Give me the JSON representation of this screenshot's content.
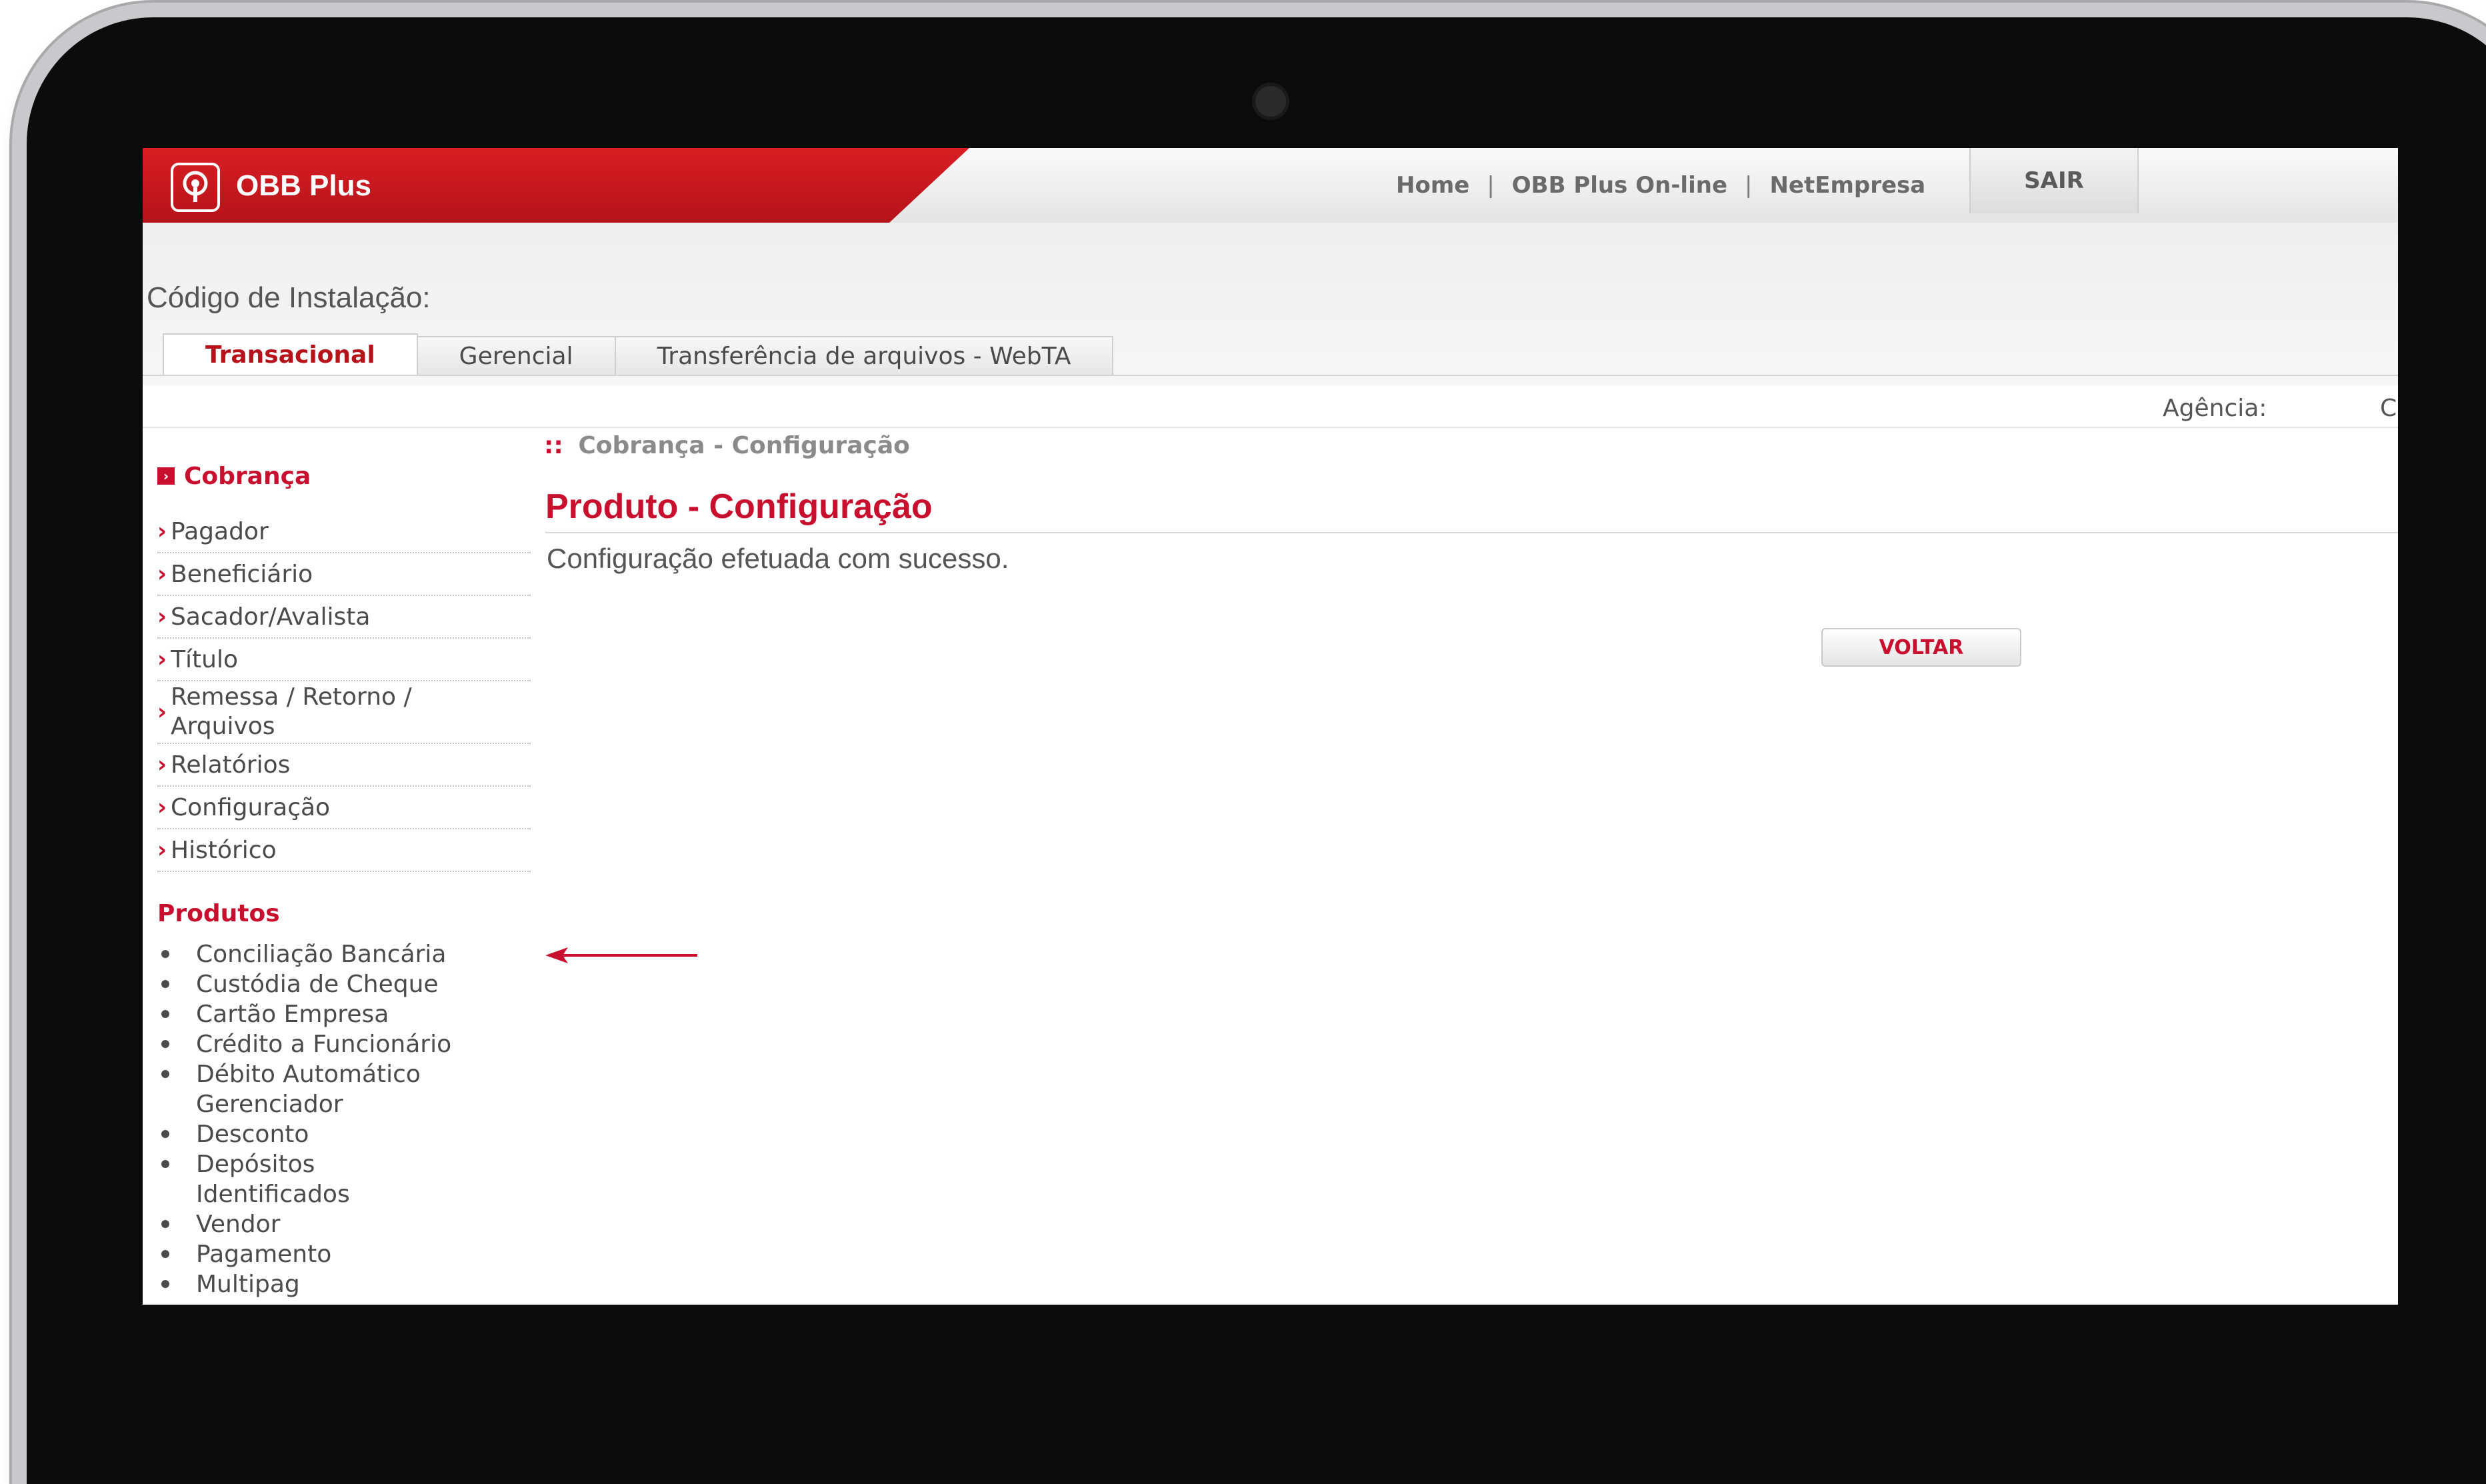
{
  "header": {
    "brand": "OBB Plus",
    "nav": [
      "Home",
      "OBB Plus On-line",
      "NetEmpresa"
    ],
    "separator": "|",
    "logout": "SAIR"
  },
  "install_code_label": "Código de Instalação:",
  "tabs": [
    {
      "label": "Transacional",
      "active": true
    },
    {
      "label": "Gerencial",
      "active": false
    },
    {
      "label": "Transferência de arquivos - WebTA",
      "active": false
    }
  ],
  "agencia_label": "Agência:",
  "agencia_value_partial": "C",
  "sidebar": {
    "section_title": "Cobrança",
    "items": [
      {
        "label": "Pagador"
      },
      {
        "label": "Beneficiário"
      },
      {
        "label": "Sacador/Avalista"
      },
      {
        "label": "Título"
      },
      {
        "label": "Remessa / Retorno / Arquivos"
      },
      {
        "label": "Relatórios"
      },
      {
        "label": "Configuração"
      },
      {
        "label": "Histórico"
      }
    ],
    "products_title": "Produtos",
    "products": [
      "Conciliação Bancária",
      "Custódia de Cheque",
      "Cartão Empresa",
      "Crédito a Funcionário",
      "Débito Automático Gerenciador",
      "Desconto",
      "Depósitos Identificados",
      "Vendor",
      "Pagamento",
      "Multipag"
    ]
  },
  "main": {
    "breadcrumb_marker": "::",
    "breadcrumb": "Cobrança - Configuração",
    "title": "Produto - Configuração",
    "message": "Configuração efetuada com sucesso.",
    "back_button": "VOLTAR"
  },
  "colors": {
    "brand_red": "#c8102e",
    "header_red": "#d81e23"
  },
  "icons": {
    "brand_logo": "obb-logo-icon",
    "camera": "camera-icon",
    "annotation_arrow": "arrow-left-icon"
  }
}
